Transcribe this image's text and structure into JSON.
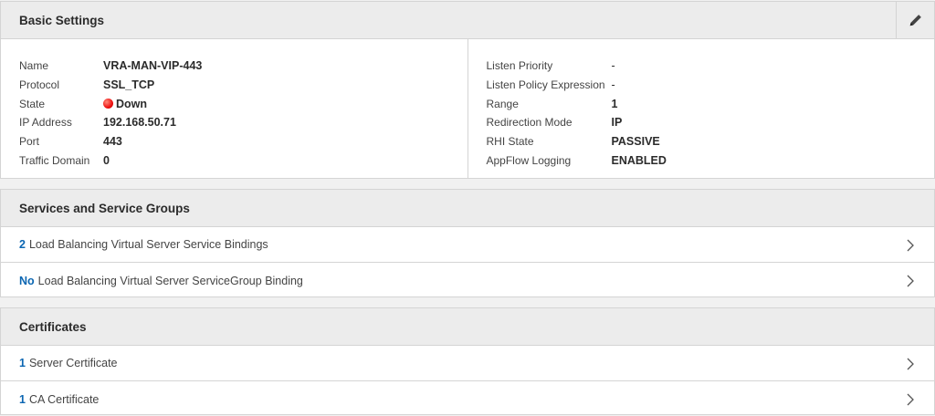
{
  "basic": {
    "title": "Basic Settings",
    "left": [
      {
        "label": "Name",
        "value": "VRA-MAN-VIP-443"
      },
      {
        "label": "Protocol",
        "value": "SSL_TCP"
      },
      {
        "label": "State",
        "value": "Down",
        "status": "down"
      },
      {
        "label": "IP Address",
        "value": "192.168.50.71"
      },
      {
        "label": "Port",
        "value": "443"
      },
      {
        "label": "Traffic Domain",
        "value": "0"
      }
    ],
    "right": [
      {
        "label": "Listen Priority",
        "value": "-"
      },
      {
        "label": "Listen Policy Expression",
        "value": "-"
      },
      {
        "label": "Range",
        "value": "1"
      },
      {
        "label": "Redirection Mode",
        "value": "IP"
      },
      {
        "label": "RHI State",
        "value": "PASSIVE"
      },
      {
        "label": "AppFlow Logging",
        "value": "ENABLED"
      }
    ]
  },
  "services": {
    "title": "Services and Service Groups",
    "items": [
      {
        "count": "2",
        "text": "Load Balancing Virtual Server Service Bindings"
      },
      {
        "count": "No",
        "text": "Load Balancing Virtual Server ServiceGroup Binding"
      }
    ]
  },
  "certificates": {
    "title": "Certificates",
    "items": [
      {
        "count": "1",
        "text": "Server Certificate"
      },
      {
        "count": "1",
        "text": "CA Certificate"
      }
    ]
  },
  "colors": {
    "link": "#0b66b2",
    "status_down": "#e11111",
    "header_bg": "#ececec",
    "border": "#d4d4d4"
  }
}
